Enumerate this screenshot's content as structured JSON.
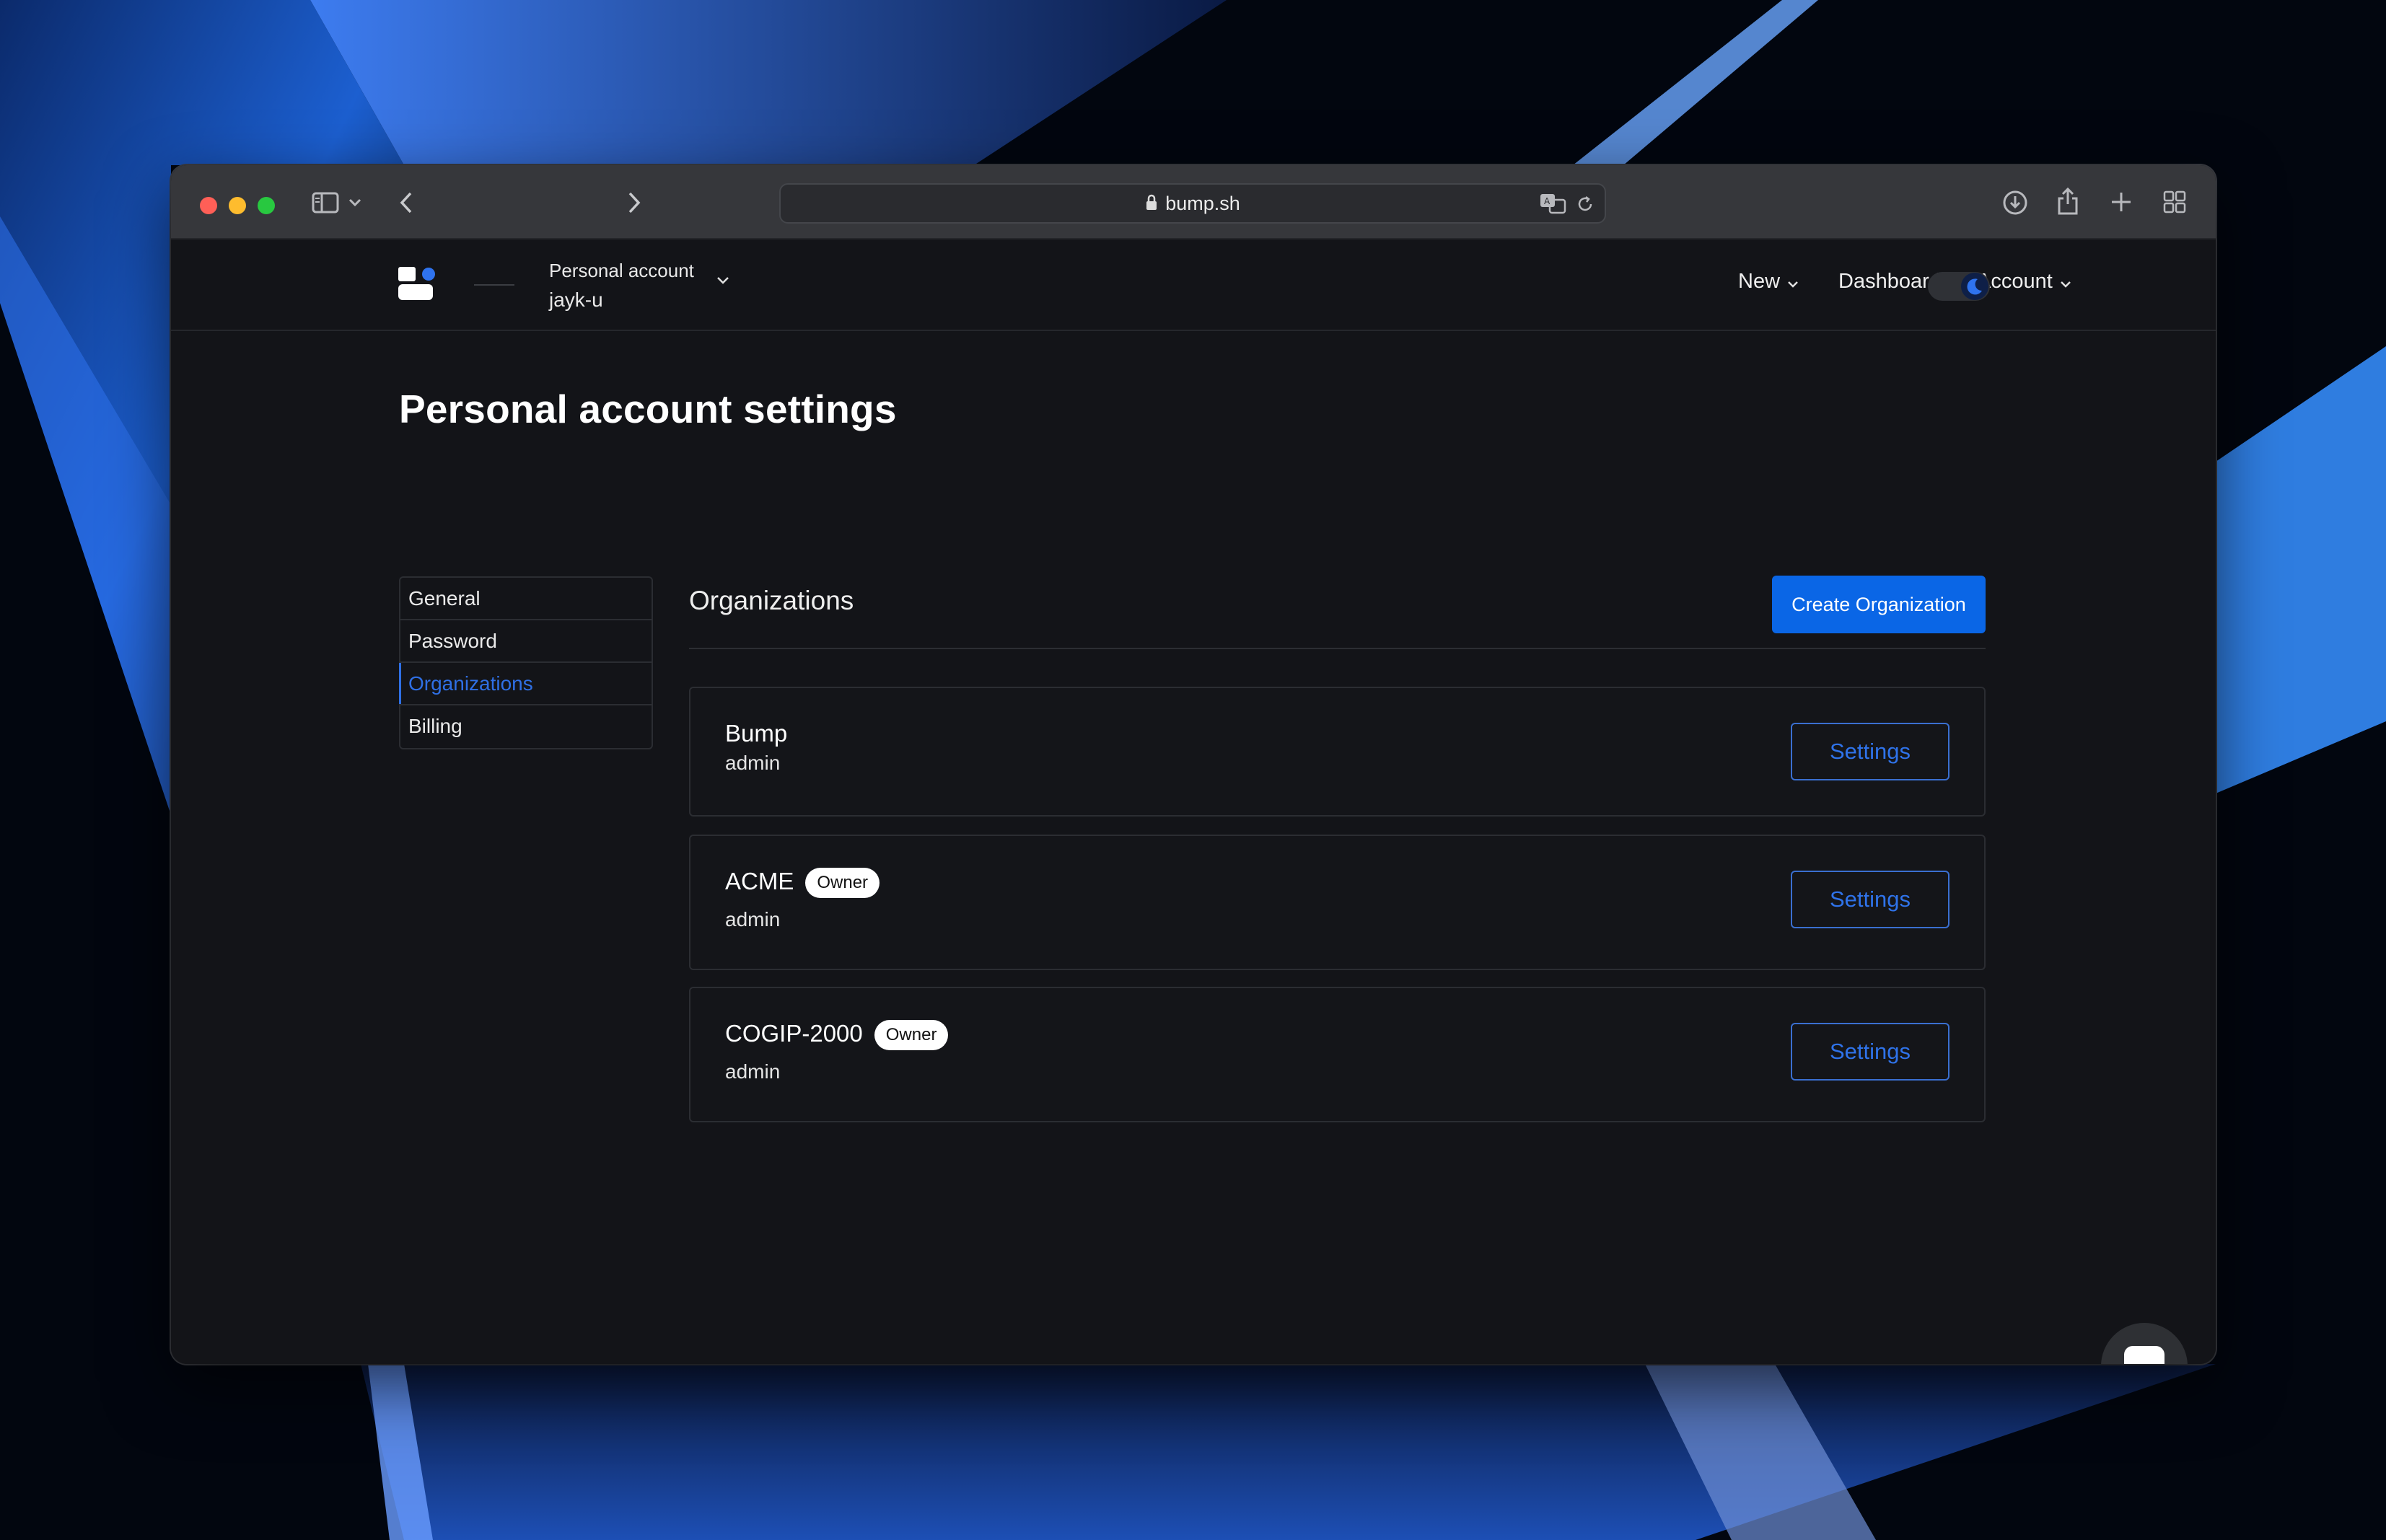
{
  "browser": {
    "url": "bump.sh"
  },
  "app": {
    "account_switcher": {
      "label": "Personal account",
      "name": "jayk-u"
    },
    "nav": {
      "new": "New",
      "dashboard": "Dashboard",
      "account": "Account"
    }
  },
  "page": {
    "title": "Personal account settings",
    "side_menu": [
      {
        "label": "General",
        "active": false
      },
      {
        "label": "Password",
        "active": false
      },
      {
        "label": "Organizations",
        "active": true
      },
      {
        "label": "Billing",
        "active": false
      }
    ],
    "section_title": "Organizations",
    "create_button": "Create Organization",
    "organizations": [
      {
        "name": "Bump",
        "role": "admin",
        "badge": "",
        "settings_label": "Settings"
      },
      {
        "name": "ACME",
        "role": "admin",
        "badge": "Owner",
        "settings_label": "Settings"
      },
      {
        "name": "COGIP-2000",
        "role": "admin",
        "badge": "Owner",
        "settings_label": "Settings"
      }
    ]
  },
  "colors": {
    "accent": "#0a66e6",
    "link_active": "#2f6fe4",
    "background": "#131418"
  }
}
